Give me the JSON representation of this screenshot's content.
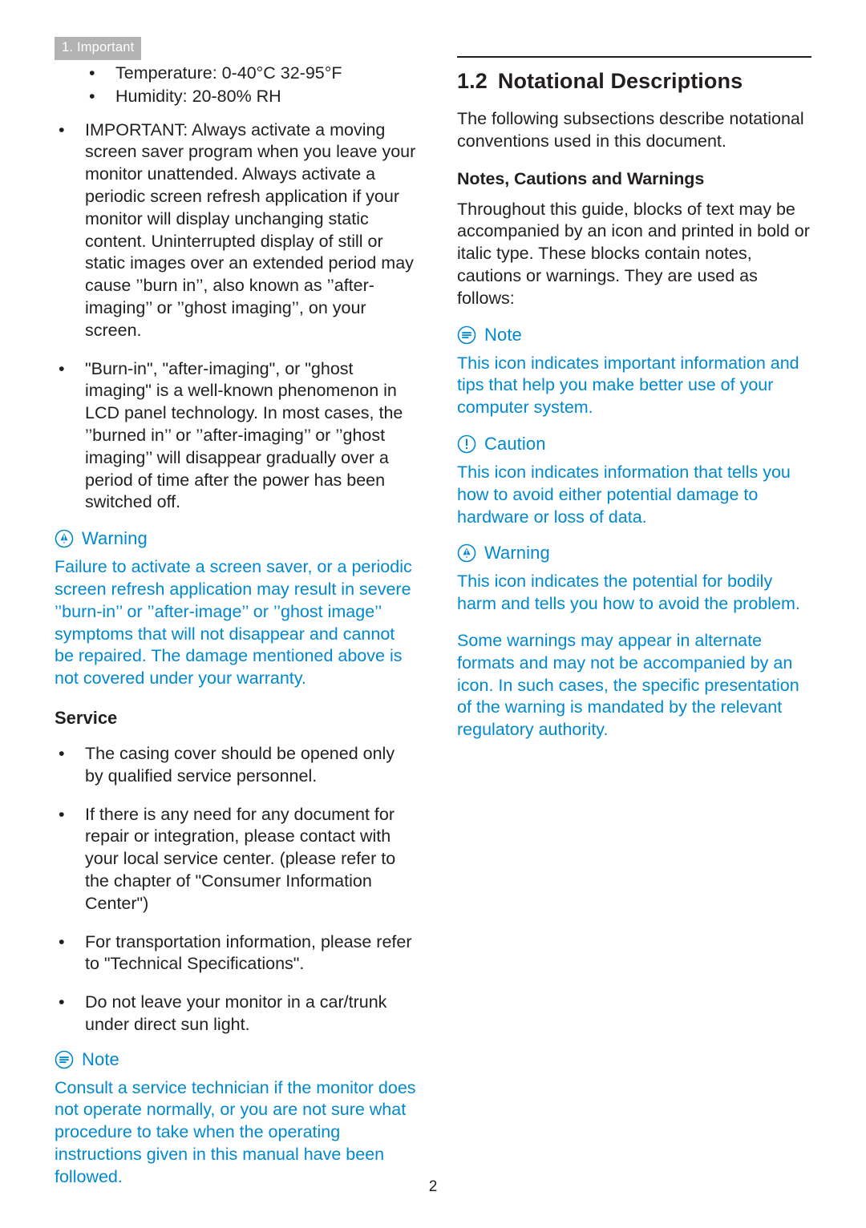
{
  "header": {
    "tab_label": "1. Important"
  },
  "left_column": {
    "spec_bullets": [
      "Temperature: 0-40°C 32-95°F",
      "Humidity: 20-80% RH"
    ],
    "bullets": [
      "IMPORTANT: Always activate a moving screen saver program when you leave your monitor unattended. Always activate a periodic screen refresh application if your monitor will display unchanging static content. Uninterrupted display of still or static images over an extended period may cause ’’burn in’’, also known as ’’after-imaging’’ or ’’ghost imaging’’, on your screen.",
      "\"Burn-in\", \"after-imaging\", or \"ghost imaging\" is a well-known phenomenon in LCD panel technology. In most cases, the ’’burned in’’ or ’’after-imaging’’ or ’’ghost imaging’’ will disappear gradually over a period of time after the power has been switched off."
    ],
    "warning": {
      "icon": "warning-icon",
      "title": "Warning",
      "text": "Failure to activate a screen saver, or a periodic screen refresh application may result in severe ’’burn-in’’ or ’’after-image’’ or ’’ghost image’’ symptoms that will not disappear and cannot be repaired. The damage mentioned above is not covered under your warranty."
    },
    "service_heading": "Service",
    "service_bullets": [
      "The casing cover should be opened only by qualified service personnel.",
      "If there is any need for any document for repair or integration, please contact with your local service center. (please refer to the chapter of \"Consumer Information Center\")",
      "For transportation information, please refer to \"Technical Specifications\".",
      "Do not leave your monitor in a car/trunk under direct sun light."
    ],
    "note": {
      "icon": "note-icon",
      "title": "Note",
      "text": "Consult a service technician if the monitor does not operate normally, or you are not sure what procedure to take when the operating instructions given in this manual have been followed."
    }
  },
  "right_column": {
    "section_number": "1.2",
    "section_title": "Notational Descriptions",
    "intro": "The following subsections describe notational conventions used in this document.",
    "sub_heading": "Notes, Cautions and Warnings",
    "sub_text": "Throughout this guide, blocks of text may be accompanied by an icon and printed in bold or italic type. These blocks contain notes, cautions or warnings. They are used as follows:",
    "note": {
      "icon": "note-icon",
      "title": "Note",
      "text": "This icon indicates important information and tips that help you make better use of your computer system."
    },
    "caution": {
      "icon": "caution-icon",
      "title": "Caution",
      "text": "This icon indicates information that tells you how to avoid either potential damage to hardware or loss of data."
    },
    "warning": {
      "icon": "warning-icon",
      "title": "Warning",
      "text": "This icon indicates the potential for bodily harm and tells you how to avoid the problem.",
      "text2": "Some warnings may appear in alternate formats and may not be accompanied by an icon. In such cases, the specific presentation of the warning is mandated by the relevant regulatory authority."
    }
  },
  "footer": {
    "page_number": "2"
  },
  "colors": {
    "accent": "#0089cf",
    "text": "#231f20",
    "tab_bg": "#b3b3b3"
  }
}
